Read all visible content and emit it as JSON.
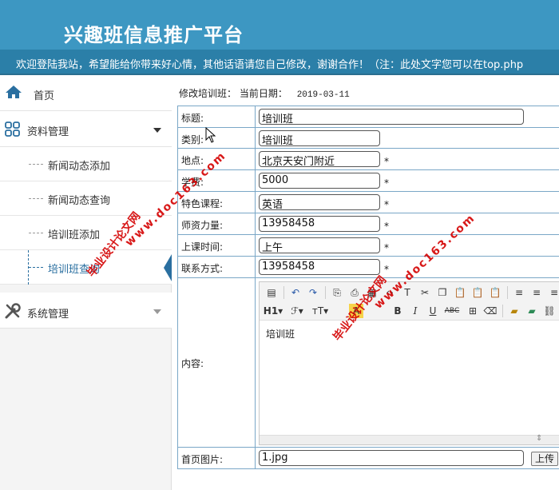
{
  "header": {
    "title": "兴趣班信息推广平台",
    "marquee": "欢迎登陆我站，希望能给你带来好心情，其他话语请您自己修改，谢谢合作！（注：此处文字您可以在top.php"
  },
  "sidebar": {
    "home": "首页",
    "group1": {
      "label": "资料管理",
      "items": [
        "新闻动态添加",
        "新闻动态查询",
        "培训班添加",
        "培训班查询"
      ]
    },
    "group2": {
      "label": "系统管理"
    }
  },
  "main": {
    "breadcrumb": "修改培训班：",
    "date_label": "当前日期：",
    "date": "2019-03-11",
    "fields": {
      "title": {
        "label": "标题:",
        "value": "培训班"
      },
      "category": {
        "label": "类别:",
        "value": "培训班"
      },
      "location": {
        "label": "地点:",
        "value": "北京天安门附近"
      },
      "tuition": {
        "label": "学费:",
        "value": "5000"
      },
      "course": {
        "label": "特色课程:",
        "value": "英语"
      },
      "teachers": {
        "label": "师资力量:",
        "value": "13958458"
      },
      "time": {
        "label": "上课时间:",
        "value": "上午"
      },
      "contact": {
        "label": "联系方式:",
        "value": "13958458"
      },
      "content": {
        "label": "内容:",
        "value": "培训班"
      },
      "image": {
        "label": "首页图片:",
        "value": "1.jpg",
        "upload": "上传"
      }
    },
    "required_mark": "*"
  },
  "watermarks": [
    "毕业设计论文网",
    "www.doc163.com"
  ],
  "colors": {
    "header": "#3d97c2",
    "marquee": "#2b7fa8",
    "accent": "#2a6fa0",
    "watermark": "#d40000"
  }
}
